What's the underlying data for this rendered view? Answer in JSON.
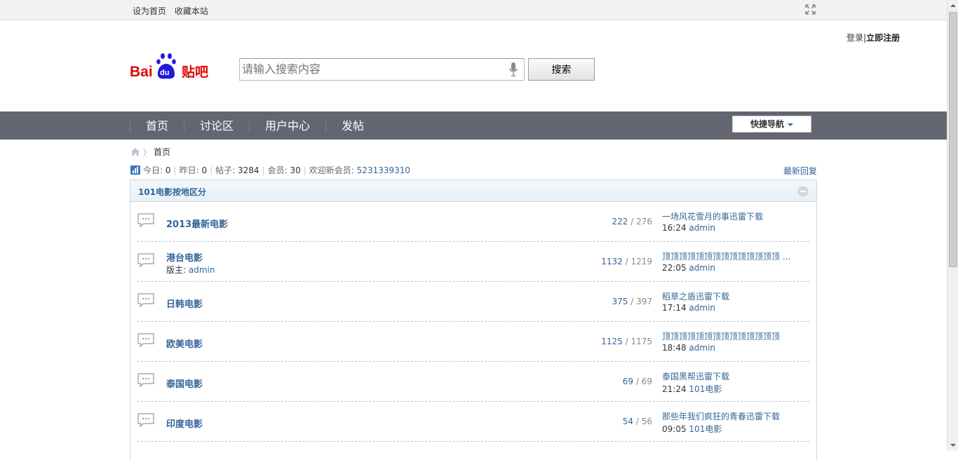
{
  "topbar": {
    "set_home": "设为首页",
    "bookmark": "收藏本站"
  },
  "header": {
    "login": "登录",
    "separator": "|",
    "register": "立即注册",
    "logo_text": "Bai du 贴吧",
    "search_placeholder": "请输入搜索内容",
    "search_button": "搜索"
  },
  "nav": {
    "items": [
      {
        "label": "首页"
      },
      {
        "label": "讨论区"
      },
      {
        "label": "用户中心"
      },
      {
        "label": "发帖"
      }
    ],
    "quick_nav": "快捷导航"
  },
  "breadcrumb": {
    "current": "首页"
  },
  "stats": {
    "today_label": "今日:",
    "today": "0",
    "yesterday_label": "昨日:",
    "yesterday": "0",
    "posts_label": "帖子:",
    "posts": "3284",
    "members_label": "会员:",
    "members": "30",
    "welcome_label": "欢迎新会员:",
    "new_member": "5231339310",
    "latest_reply": "最新回复"
  },
  "forum": {
    "section_title": "101电影按地区分",
    "rows": [
      {
        "name": "2013最新电影",
        "moderator_label": "",
        "moderator": "",
        "threads": "222",
        "posts": "276",
        "last_title": "一场风花雪月的事迅雷下载",
        "last_time": "16:24",
        "last_user": "admin"
      },
      {
        "name": "港台电影",
        "moderator_label": "版主:",
        "moderator": "admin",
        "threads": "1132",
        "posts": "1219",
        "last_title": "顶顶顶顶顶顶顶顶顶顶顶顶顶顶 ...",
        "last_time": "22:05",
        "last_user": "admin"
      },
      {
        "name": "日韩电影",
        "moderator_label": "",
        "moderator": "",
        "threads": "375",
        "posts": "397",
        "last_title": "稻草之盾迅雷下载",
        "last_time": "17:14",
        "last_user": "admin"
      },
      {
        "name": "欧美电影",
        "moderator_label": "",
        "moderator": "",
        "threads": "1125",
        "posts": "1175",
        "last_title": "顶顶顶顶顶顶顶顶顶顶顶顶顶顶",
        "last_time": "18:48",
        "last_user": "admin"
      },
      {
        "name": "泰国电影",
        "moderator_label": "",
        "moderator": "",
        "threads": "69",
        "posts": "69",
        "last_title": "泰国黑帮迅雷下载",
        "last_time": "21:24",
        "last_user": "101电影"
      },
      {
        "name": "印度电影",
        "moderator_label": "",
        "moderator": "",
        "threads": "54",
        "posts": "56",
        "last_title": "那些年我们疯狂的青春迅雷下载",
        "last_time": "09:05",
        "last_user": "101电影"
      }
    ]
  },
  "colors": {
    "nav_bg": "#636570",
    "link": "#336699",
    "logo_red": "#e10602",
    "logo_blue": "#2319dc"
  }
}
